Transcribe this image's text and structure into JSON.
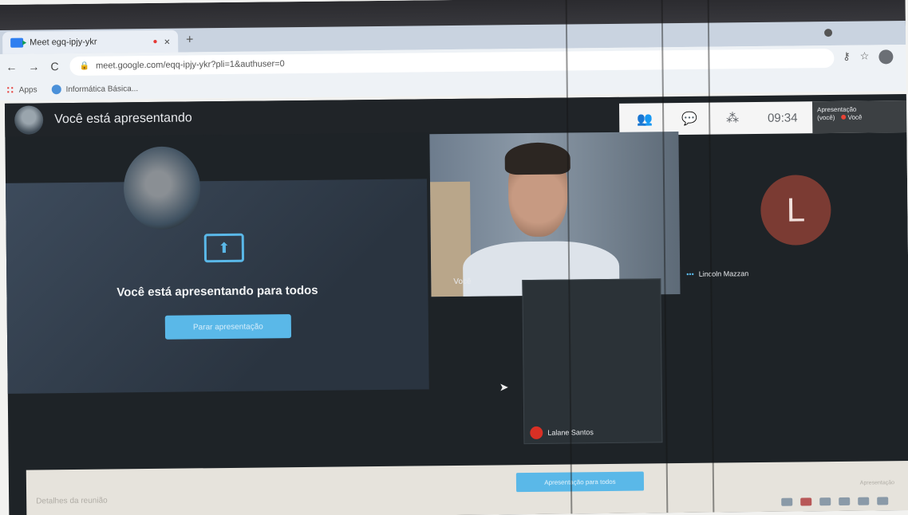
{
  "browser": {
    "tab_title": "Meet egq-ipjy-ykr",
    "tab_recording": "●",
    "tab_close": "×",
    "new_tab": "+",
    "url": "meet.google.com/eqq-ipjy-ykr?pli=1&authuser=0",
    "bookmarks": [
      {
        "label": "Apps"
      },
      {
        "label": "Informática Básica..."
      }
    ]
  },
  "meet": {
    "header_title": "Você está apresentando",
    "clock": "09:34",
    "present_badge_line1": "Apresentação",
    "present_badge_line2": "(você)",
    "present_badge_line3": "Você",
    "present_message": "Você está apresentando para todos",
    "stop_button": "Parar apresentação",
    "video_name": "Você",
    "side_participant": "Lincoln Mazzan",
    "side_avatar_letter": "L",
    "pip_participant": "Lalane Santos",
    "bottom_left": "Detalhes da reunião",
    "bottom_cta": "Apresentação para todos",
    "bottom_right": "Apresentação"
  }
}
